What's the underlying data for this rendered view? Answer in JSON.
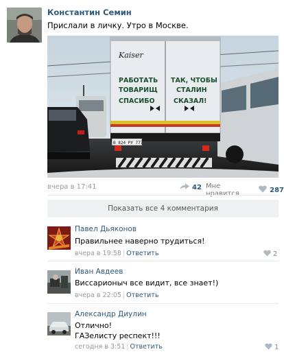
{
  "post": {
    "author": "Константин Семин",
    "text": "Прислали в личку. Утро в Москве.",
    "date": "вчера в 17:41",
    "share_count": "42",
    "like_label": "Мне нравится",
    "like_count": "287",
    "truck": {
      "brand": "Kaiser",
      "left_lines": [
        "РАБОТАТЬ",
        "ТОВАРИЩ",
        "СПАСИБО"
      ],
      "right_lines": [
        "ТАК, ЧТОБЫ",
        "СТАЛИН",
        "СКАЗАЛ!"
      ],
      "plate": "В 824 РУ 777"
    }
  },
  "comments_toggle": "Показать все 4 комментария",
  "comments": [
    {
      "author": "Павел Дьяконов",
      "lines": [
        "Правильнее наверно трудиться!"
      ],
      "date": "вчера в 19:58",
      "reply": "Ответить",
      "likes": "2"
    },
    {
      "author": "Иван Авдеев",
      "lines": [
        "Виссарионыч все видит, все знает!)"
      ],
      "date": "вчера в 22:05",
      "reply": "Ответить",
      "likes": ""
    },
    {
      "author": "Александр Диулин",
      "lines": [
        "Отлично!",
        "ГАЗелисту респект!!!"
      ],
      "date": "сегодня в 3:51",
      "reply": "Ответить",
      "likes": "1"
    }
  ],
  "colors": {
    "link": "#2b587a",
    "muted": "#999999",
    "panel": "#eef1f4"
  }
}
